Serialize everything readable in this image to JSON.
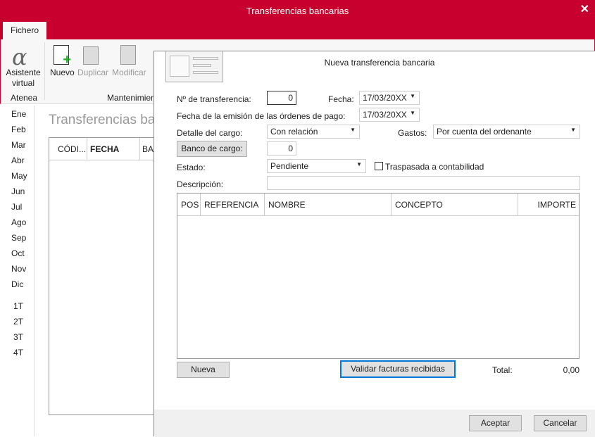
{
  "window": {
    "title": "Transferencias bancarias",
    "close": "✕"
  },
  "tabs": [
    {
      "label": "Fichero"
    }
  ],
  "ribbon": {
    "asistente": "Asistente virtual",
    "atenea": "Atenea",
    "nuevo": "Nuevo",
    "duplicar": "Duplicar",
    "modificar": "Modificar",
    "mantenimiento": "Mantenimien"
  },
  "sidebar": {
    "months": [
      "Ene",
      "Feb",
      "Mar",
      "Abr",
      "May",
      "Jun",
      "Jul",
      "Ago",
      "Sep",
      "Oct",
      "Nov",
      "Dic"
    ],
    "quarters": [
      "1T",
      "2T",
      "3T",
      "4T"
    ]
  },
  "list": {
    "title": "Transferencias ba",
    "columns": [
      "CÓDI...",
      "FECHA",
      "BA"
    ]
  },
  "dialog": {
    "title": "Nueva transferencia bancaria",
    "num_label": "Nº de transferencia:",
    "num_value": "0",
    "fecha_label": "Fecha:",
    "fecha_value": "17/03/20XX",
    "emision_label": "Fecha de la emisión de las órdenes de pago:",
    "emision_value": "17/03/20XX",
    "detalle_label": "Detalle del cargo:",
    "detalle_value": "Con relación",
    "gastos_label": "Gastos:",
    "gastos_value": "Por cuenta del ordenante",
    "banco_button": "Banco de cargo:",
    "banco_value": "0",
    "estado_label": "Estado:",
    "estado_value": "Pendiente",
    "traspasada_label": "Traspasada a contabilidad",
    "traspasada_checked": false,
    "descripcion_label": "Descripción:",
    "descripcion_value": "",
    "grid_columns": [
      "POS",
      "REFERENCIA",
      "NOMBRE",
      "CONCEPTO",
      "IMPORTE"
    ],
    "nueva_button": "Nueva",
    "validar_button": "Validar facturas recibidas",
    "total_label": "Total:",
    "total_value": "0,00",
    "aceptar": "Aceptar",
    "cancelar": "Cancelar"
  }
}
